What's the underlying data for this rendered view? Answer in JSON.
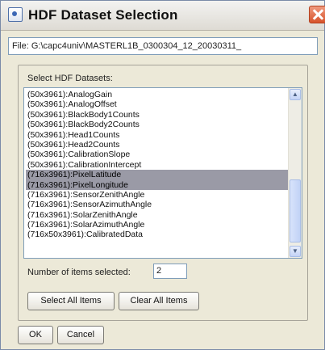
{
  "window": {
    "title": "HDF Dataset Selection",
    "icon": "app-window-icon",
    "close_icon": "close-icon"
  },
  "file": {
    "value": "File: G:\\capc4univ\\MASTERL1B_0300304_12_20030311_"
  },
  "datasets": {
    "label": "Select HDF Datasets:",
    "items": [
      {
        "label": "(50x3961):AnalogGain",
        "selected": false
      },
      {
        "label": "(50x3961):AnalogOffset",
        "selected": false
      },
      {
        "label": "(50x3961):BlackBody1Counts",
        "selected": false
      },
      {
        "label": "(50x3961):BlackBody2Counts",
        "selected": false
      },
      {
        "label": "(50x3961):Head1Counts",
        "selected": false
      },
      {
        "label": "(50x3961):Head2Counts",
        "selected": false
      },
      {
        "label": "(50x3961):CalibrationSlope",
        "selected": false
      },
      {
        "label": "(50x3961):CalibrationIntercept",
        "selected": false
      },
      {
        "label": "(716x3961):PixelLatitude",
        "selected": true
      },
      {
        "label": "(716x3961):PixelLongitude",
        "selected": true
      },
      {
        "label": "(716x3961):SensorZenithAngle",
        "selected": false
      },
      {
        "label": "(716x3961):SensorAzimuthAngle",
        "selected": false
      },
      {
        "label": "(716x3961):SolarZenithAngle",
        "selected": false
      },
      {
        "label": "(716x3961):SolarAzimuthAngle",
        "selected": false
      },
      {
        "label": "(716x50x3961):CalibratedData",
        "selected": false
      }
    ],
    "selection_color": "#9a9aa6"
  },
  "count": {
    "label": "Number of items selected:",
    "value": "2"
  },
  "buttons": {
    "select_all": "Select All Items",
    "clear_all": "Clear All Items",
    "ok": "OK",
    "cancel": "Cancel"
  },
  "colors": {
    "window_bg": "#ece9d8",
    "close_button": "#d7532c",
    "field_border": "#7f9db9"
  }
}
